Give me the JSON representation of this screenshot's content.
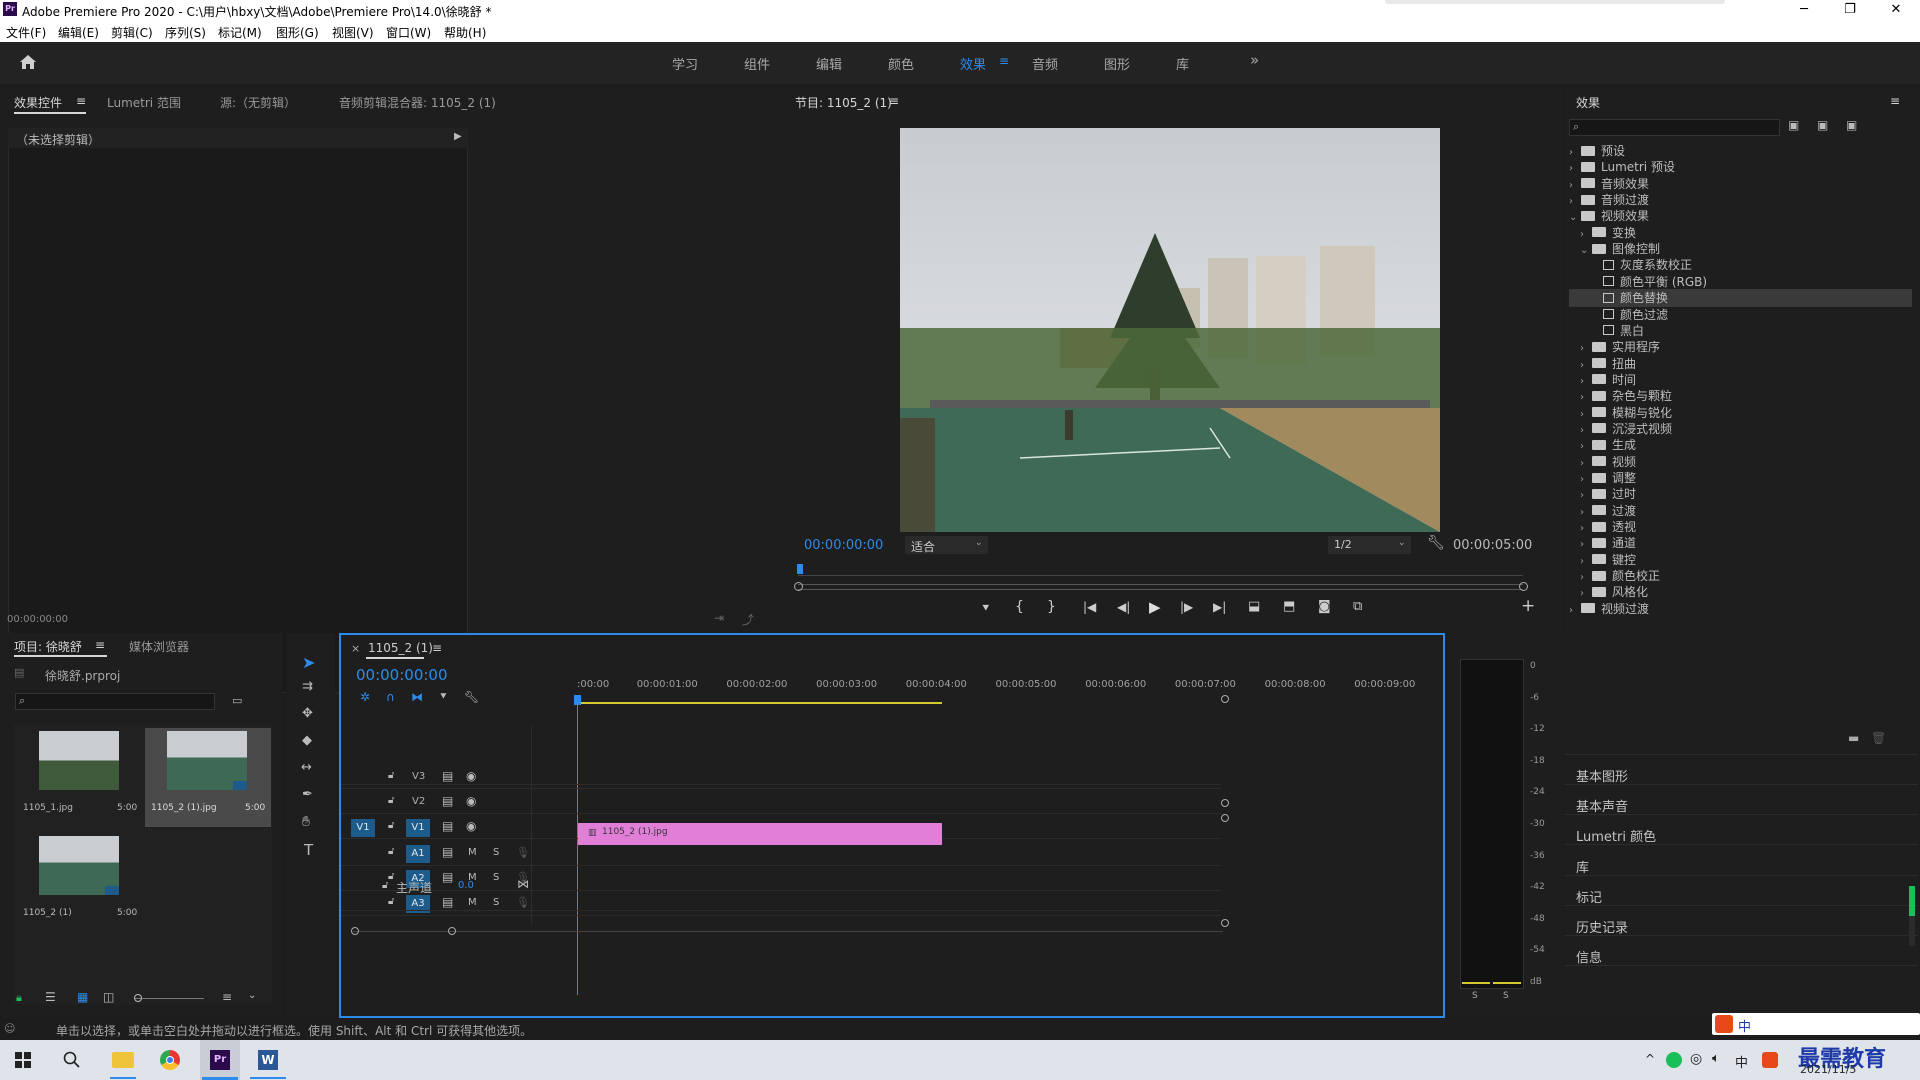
{
  "window": {
    "title": "Adobe Premiere Pro 2020 - C:\\用户\\hbxy\\文档\\Adobe\\Premiere Pro\\14.0\\徐晓舒 *",
    "app_icon": "Pr",
    "minimize": "─",
    "maximize": "❐",
    "close": "✕"
  },
  "menu": [
    "文件(F)",
    "编辑(E)",
    "剪辑(C)",
    "序列(S)",
    "标记(M)",
    "图形(G)",
    "视图(V)",
    "窗口(W)",
    "帮助(H)"
  ],
  "workspaces": {
    "items": [
      "学习",
      "组件",
      "编辑",
      "颜色",
      "效果",
      "音频",
      "图形",
      "库"
    ],
    "active": "效果",
    "more": "»"
  },
  "source_panel": {
    "tabs": [
      "效果控件",
      "Lumetri 范围",
      "源:（无剪辑）",
      "音频剪辑混合器: 1105_2 (1)"
    ],
    "menu_icon": "≡",
    "no_clip": "（未选择剪辑）",
    "timecode": "00:00:00:00"
  },
  "program_monitor": {
    "title": "节目: 1105_2 (1)",
    "menu_icon": "≡",
    "timecode_current": "00:00:00:00",
    "fit": "适合",
    "quality": "1/2",
    "timecode_duration": "00:00:05:00"
  },
  "project_panel": {
    "tabs": [
      "项目: 徐晓舒",
      "媒体浏览器"
    ],
    "menu_icon": "≡",
    "file": "徐晓舒.prproj",
    "items": [
      {
        "name": "1105_1.jpg",
        "duration": "5:00"
      },
      {
        "name": "1105_2 (1).jpg",
        "duration": "5:00"
      },
      {
        "name": "1105_2 (1)",
        "duration": "5:00"
      }
    ]
  },
  "timeline": {
    "tab": "1105_2 (1)",
    "close": "×",
    "menu_icon": "≡",
    "timecode": "00:00:00:00",
    "ruler": [
      ":00:00",
      "00:00:01:00",
      "00:00:02:00",
      "00:00:03:00",
      "00:00:04:00",
      "00:00:05:00",
      "00:00:06:00",
      "00:00:07:00",
      "00:00:08:00",
      "00:00:09:00"
    ],
    "video_tracks": [
      "V3",
      "V2",
      "V1"
    ],
    "audio_tracks": [
      "A1",
      "A2",
      "A3"
    ],
    "source_patch": "V1",
    "mute": "M",
    "solo": "S",
    "master": "主声道",
    "master_value": "0.0",
    "clip_label": "1105_2 (1).jpg",
    "clip_color": "#e17fd8"
  },
  "audio_meter": {
    "scale": [
      "0",
      "-6",
      "-12",
      "-18",
      "-24",
      "-30",
      "-36",
      "-42",
      "-48",
      "-54",
      "dB"
    ],
    "solo_labels": [
      "S",
      "S"
    ]
  },
  "effects_panel": {
    "title": "效果",
    "menu_icon": "≡",
    "tree": [
      {
        "label": "预设",
        "level": 0,
        "kind": "folder-special",
        "open": false
      },
      {
        "label": "Lumetri 预设",
        "level": 0,
        "kind": "folder-special",
        "open": false
      },
      {
        "label": "音频效果",
        "level": 0,
        "kind": "folder",
        "open": false
      },
      {
        "label": "音频过渡",
        "level": 0,
        "kind": "folder",
        "open": false
      },
      {
        "label": "视频效果",
        "level": 0,
        "kind": "folder",
        "open": true
      },
      {
        "label": "变换",
        "level": 1,
        "kind": "folder",
        "open": false
      },
      {
        "label": "图像控制",
        "level": 1,
        "kind": "folder",
        "open": true
      },
      {
        "label": "灰度系数校正",
        "level": 2,
        "kind": "fx"
      },
      {
        "label": "颜色平衡 (RGB)",
        "level": 2,
        "kind": "fx"
      },
      {
        "label": "颜色替换",
        "level": 2,
        "kind": "fx",
        "selected": true
      },
      {
        "label": "颜色过滤",
        "level": 2,
        "kind": "fx"
      },
      {
        "label": "黑白",
        "level": 2,
        "kind": "fx"
      },
      {
        "label": "实用程序",
        "level": 1,
        "kind": "folder",
        "open": false
      },
      {
        "label": "扭曲",
        "level": 1,
        "kind": "folder",
        "open": false
      },
      {
        "label": "时间",
        "level": 1,
        "kind": "folder",
        "open": false
      },
      {
        "label": "杂色与颗粒",
        "level": 1,
        "kind": "folder",
        "open": false
      },
      {
        "label": "模糊与锐化",
        "level": 1,
        "kind": "folder",
        "open": false
      },
      {
        "label": "沉浸式视频",
        "level": 1,
        "kind": "folder",
        "open": false
      },
      {
        "label": "生成",
        "level": 1,
        "kind": "folder",
        "open": false
      },
      {
        "label": "视频",
        "level": 1,
        "kind": "folder",
        "open": false
      },
      {
        "label": "调整",
        "level": 1,
        "kind": "folder",
        "open": false
      },
      {
        "label": "过时",
        "level": 1,
        "kind": "folder",
        "open": false
      },
      {
        "label": "过渡",
        "level": 1,
        "kind": "folder",
        "open": false
      },
      {
        "label": "透视",
        "level": 1,
        "kind": "folder",
        "open": false
      },
      {
        "label": "通道",
        "level": 1,
        "kind": "folder",
        "open": false
      },
      {
        "label": "键控",
        "level": 1,
        "kind": "folder",
        "open": false
      },
      {
        "label": "颜色校正",
        "level": 1,
        "kind": "folder",
        "open": false
      },
      {
        "label": "风格化",
        "level": 1,
        "kind": "folder",
        "open": false
      },
      {
        "label": "视频过渡",
        "level": 0,
        "kind": "folder",
        "open": false
      }
    ],
    "collapsed_panels": [
      "基本图形",
      "基本声音",
      "Lumetri 颜色",
      "库",
      "标记",
      "历史记录",
      "信息"
    ]
  },
  "status_bar": {
    "text": "单击以选择，或单击空白处并拖动以进行框选。使用 Shift、Alt 和 Ctrl 可获得其他选项。"
  },
  "taskbar": {
    "date": "2021/11/5",
    "watermark": "最需教育",
    "ime": "中",
    "apps": [
      "windows-start",
      "search",
      "file-explorer",
      "chrome",
      "premiere",
      "word"
    ],
    "tray_icons": [
      "up-chevron",
      "wechat",
      "network",
      "volume",
      "ime",
      "sogou"
    ],
    "app_glyphs": {
      "premiere": "Pr",
      "word": "W"
    },
    "tray_glyphs": {
      "up-chevron": "^",
      "network": "◎",
      "volume": "🔈︎"
    }
  }
}
